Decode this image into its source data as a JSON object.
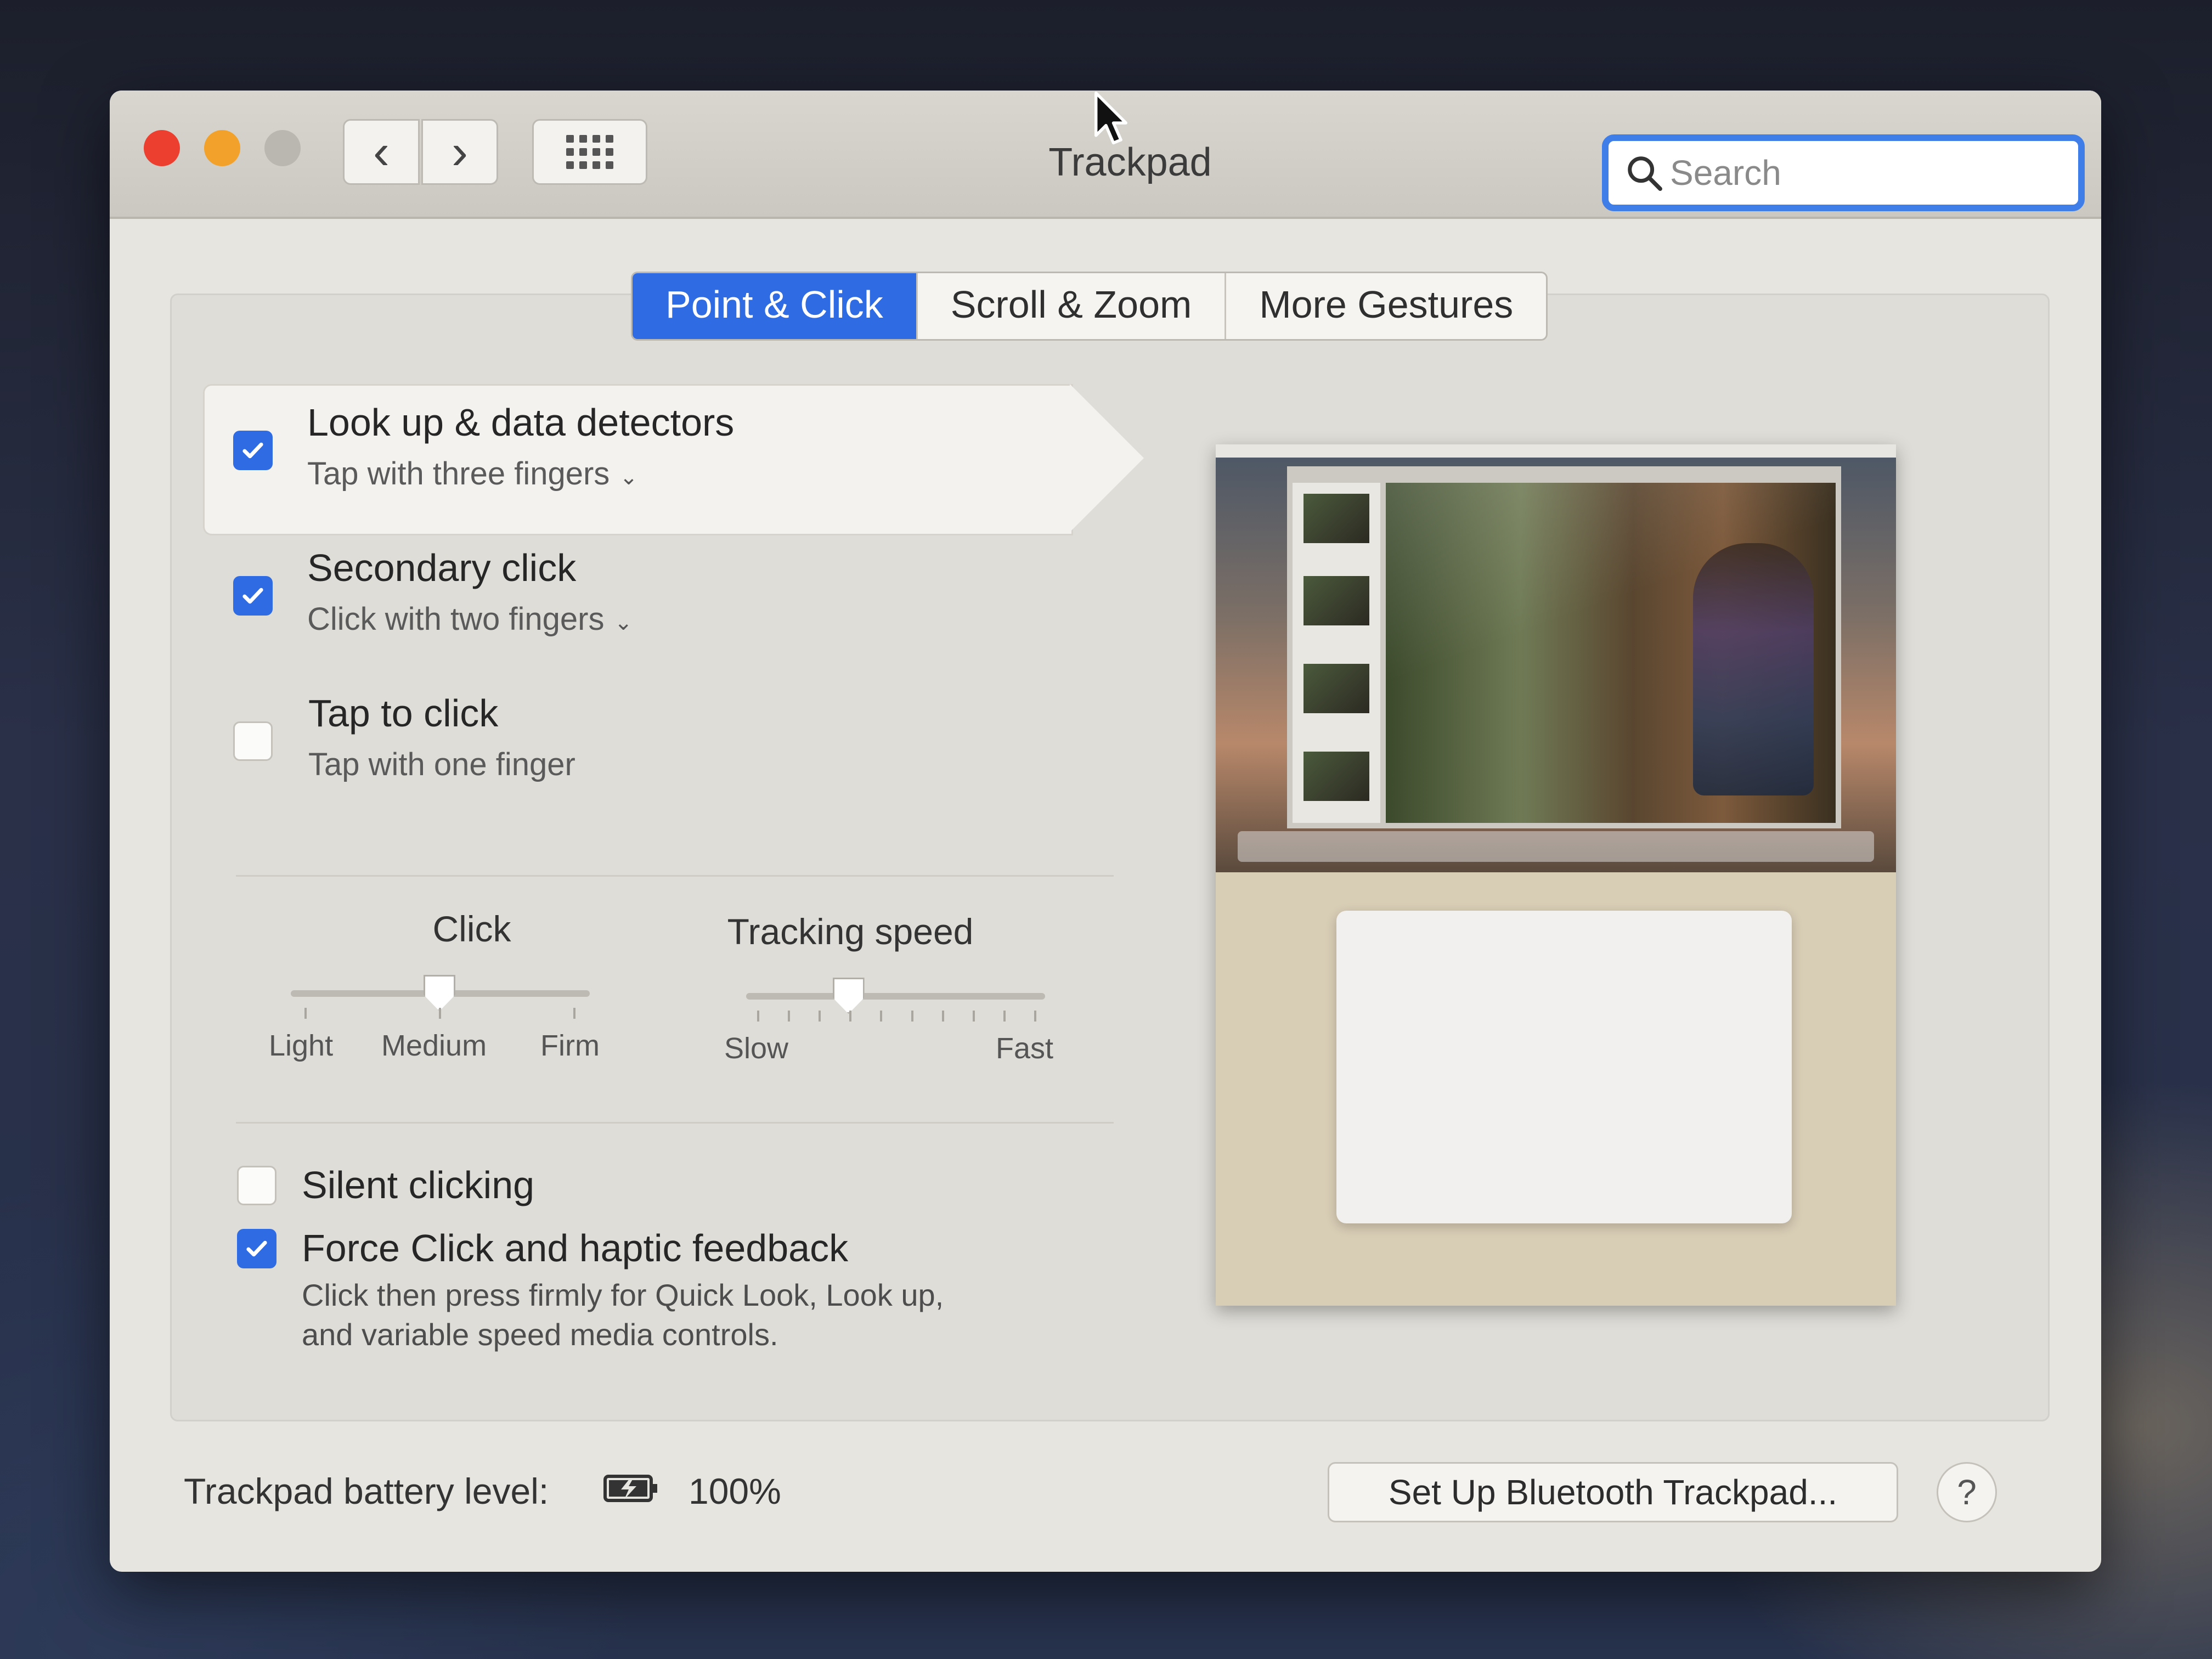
{
  "window": {
    "title": "Trackpad",
    "search_placeholder": "Search",
    "accent": "#2f6be3"
  },
  "tabs": [
    {
      "label": "Point & Click",
      "active": true
    },
    {
      "label": "Scroll & Zoom",
      "active": false
    },
    {
      "label": "More Gestures",
      "active": false
    }
  ],
  "options": {
    "lookup": {
      "title": "Look up & data detectors",
      "sub": "Tap with three fingers",
      "checked": true
    },
    "secondary": {
      "title": "Secondary click",
      "sub": "Click with two fingers",
      "checked": true
    },
    "tap": {
      "title": "Tap to click",
      "sub": "Tap with one finger",
      "checked": false
    }
  },
  "sliders": {
    "click": {
      "label": "Click",
      "ticks": [
        "Light",
        "Medium",
        "Firm"
      ],
      "value": "Medium"
    },
    "tracking": {
      "label": "Tracking speed",
      "min_label": "Slow",
      "max_label": "Fast",
      "value_fraction": 0.33
    }
  },
  "bottom_options": {
    "silent": {
      "title": "Silent clicking",
      "checked": false
    },
    "force": {
      "title": "Force Click and haptic feedback",
      "checked": true,
      "desc_line1": "Click then press firmly for Quick Look, Look up,",
      "desc_line2": "and variable speed media controls."
    }
  },
  "footer": {
    "battery_label": "Trackpad battery level:",
    "battery_value": "100%",
    "setup_button": "Set Up Bluetooth Trackpad...",
    "help_button": "?"
  }
}
